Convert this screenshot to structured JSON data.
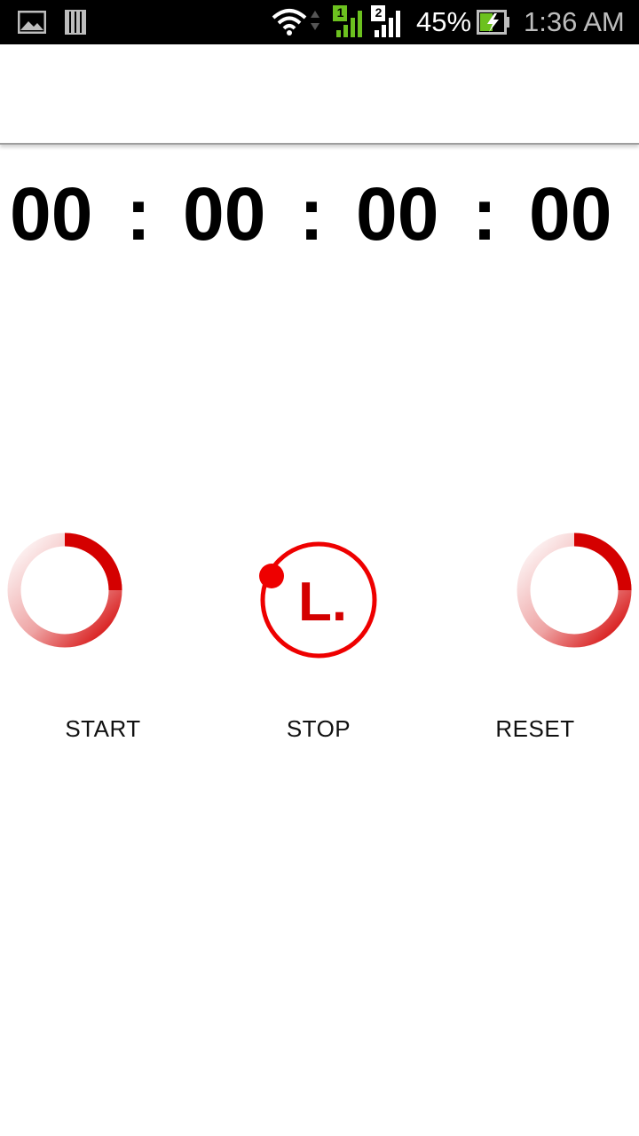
{
  "status_bar": {
    "battery_percent": "45%",
    "time": "1:36 AM",
    "sim1_label": "1",
    "sim2_label": "2",
    "icons": [
      "gallery-icon",
      "storage-icon",
      "wifi-icon",
      "signal-sim1-icon",
      "signal-sim2-icon",
      "battery-charging-icon"
    ]
  },
  "timer": {
    "hours": "00",
    "minutes": "00",
    "seconds": "00",
    "centiseconds": "00",
    "separator": ":"
  },
  "controls": {
    "start_label": "START",
    "stop_label": "STOP",
    "reset_label": "RESET",
    "stop_icon_text": "L."
  },
  "colors": {
    "accent_red": "#e00000",
    "ring_fade": "#f4d0d0",
    "status_bar_bg": "#000000",
    "sim1_green": "#6cc11f"
  }
}
